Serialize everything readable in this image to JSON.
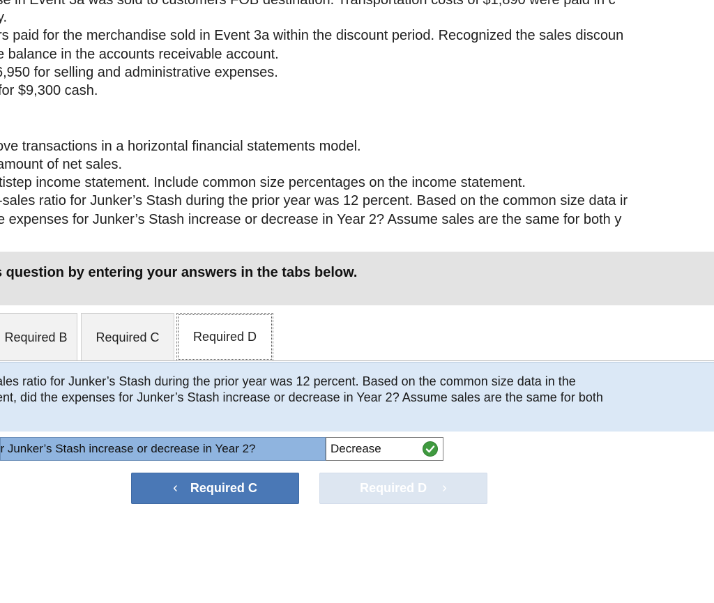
{
  "problem_text": {
    "lines": [
      "ise in Event 3a was sold to customers FOB destination. Transportation costs of $1,890 were paid in c",
      "y.",
      "rs paid for the merchandise sold in Event 3a within the discount period. Recognized the sales discoun",
      "e balance in the accounts receivable account.",
      "6,950 for selling and administrative expenses.",
      "for $9,300 cash.",
      "ove transactions in a horizontal financial statements model.",
      "amount of net sales.",
      "tistep income statement. Include common size percentages on the income statement.",
      "-sales ratio for Junker’s Stash during the prior year was 12 percent. Based on the common size data ir",
      "e expenses for Junker’s Stash increase or decrease in Year 2? Assume sales are the same for both y"
    ]
  },
  "banner": {
    "text": "s question by entering your answers in the tabs below."
  },
  "tabs": [
    {
      "label": "Required B",
      "active": false
    },
    {
      "label": "Required C",
      "active": false
    },
    {
      "label": "Required D",
      "active": true
    }
  ],
  "question": {
    "line1": "ales ratio for Junker’s Stash during the prior year was 12 percent. Based on the common size data in the",
    "line2": "ent, did the expenses for Junker’s Stash increase or decrease in Year 2? Assume sales are the same for both"
  },
  "answer": {
    "label": "or Junker’s Stash increase or decrease in Year 2?",
    "value": "Decrease",
    "status_icon": "check-icon",
    "status_color": "#3f9a3f"
  },
  "navigation": {
    "prev_label": "Required C",
    "next_label": "Required D",
    "prev_icon": "chevron-left-icon",
    "next_icon": "chevron-right-icon",
    "prev_color": "#4a78b6",
    "next_color": "#dde6f1"
  }
}
